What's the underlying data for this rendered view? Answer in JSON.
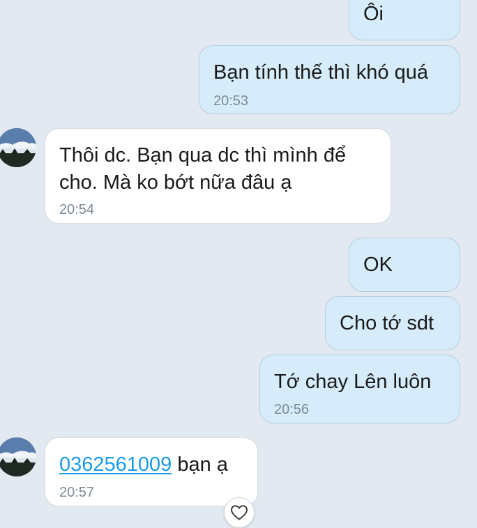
{
  "messages": [
    {
      "direction": "out",
      "text": "Ôi",
      "time": ""
    },
    {
      "direction": "out",
      "text": "Bạn tính thế thì khó quá",
      "time": "20:53"
    },
    {
      "direction": "in",
      "text": "Thôi dc. Bạn qua dc thì mình để cho. Mà ko bớt nữa đâu ạ",
      "time": "20:54"
    },
    {
      "direction": "out",
      "text": "OK",
      "time": ""
    },
    {
      "direction": "out",
      "text": "Cho tớ sdt",
      "time": ""
    },
    {
      "direction": "out",
      "text": "Tớ chay Lên luôn",
      "time": "20:56"
    },
    {
      "direction": "in",
      "phone": "0362561009",
      "text": " bạn ạ",
      "time": "20:57"
    }
  ],
  "colors": {
    "background": "#e3e9f0",
    "outgoing_bubble": "#d6ecfa",
    "incoming_bubble": "#ffffff",
    "link": "#1a9be6",
    "timestamp": "#7d8a96"
  },
  "icons": {
    "reaction": "heart-icon",
    "avatar": "contact-avatar"
  }
}
